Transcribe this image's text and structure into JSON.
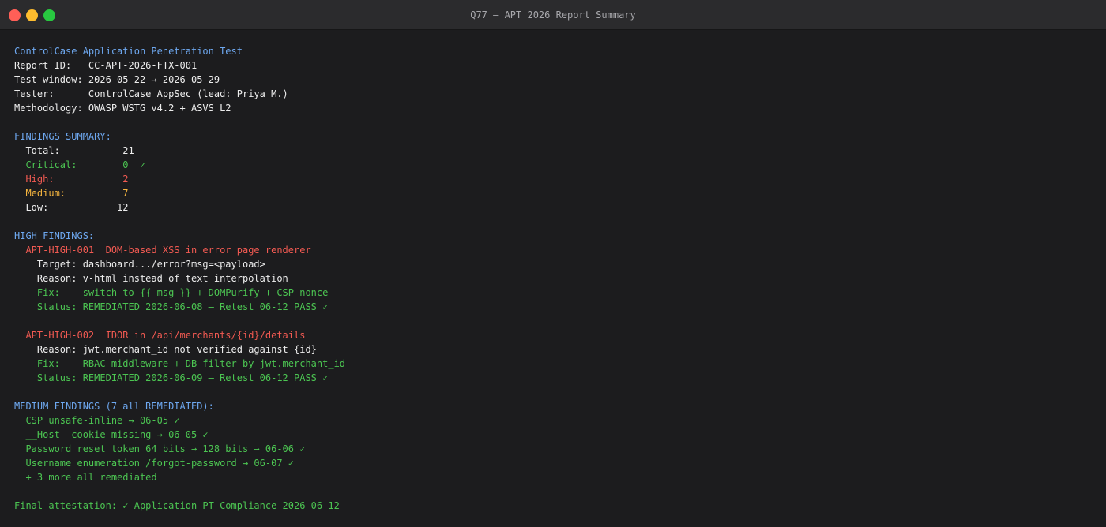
{
  "window": {
    "title": "Q77 — APT 2026 Report Summary"
  },
  "colors": {
    "heading": "#6ea8f0",
    "text": "#ededed",
    "success": "#4cc552",
    "high": "#f25a52",
    "medium": "#f5b53f",
    "background": "#1c1c1e",
    "titlebar": "#2b2b2d"
  },
  "report": {
    "heading": "ControlCase Application Penetration Test",
    "report_id": "Report ID:   CC-APT-2026-FTX-001",
    "test_window": "Test window: 2026-05-22 → 2026-05-29",
    "tester": "Tester:      ControlCase AppSec (lead: Priya M.)",
    "methodology": "Methodology: OWASP WSTG v4.2 + ASVS L2"
  },
  "summary": {
    "heading": "FINDINGS SUMMARY:",
    "total": "  Total:           21",
    "critical": "  Critical:        0  ✓",
    "high": "  High:            2",
    "medium": "  Medium:          7",
    "low": "  Low:            12"
  },
  "high_findings": {
    "heading": "HIGH FINDINGS:",
    "items": [
      {
        "title": "  APT-HIGH-001  DOM-based XSS in error page renderer",
        "details": [
          {
            "text": "    Target: dashboard.../error?msg=<payload>",
            "tone": "white"
          },
          {
            "text": "    Reason: v-html instead of text interpolation",
            "tone": "white"
          },
          {
            "text": "    Fix:    switch to {{ msg }} + DOMPurify + CSP nonce",
            "tone": "green"
          },
          {
            "text": "    Status: REMEDIATED 2026-06-08 — Retest 06-12 PASS ✓",
            "tone": "green"
          }
        ]
      },
      {
        "title": "  APT-HIGH-002  IDOR in /api/merchants/{id}/details",
        "details": [
          {
            "text": "    Reason: jwt.merchant_id not verified against {id}",
            "tone": "white"
          },
          {
            "text": "    Fix:    RBAC middleware + DB filter by jwt.merchant_id",
            "tone": "green"
          },
          {
            "text": "    Status: REMEDIATED 2026-06-09 — Retest 06-12 PASS ✓",
            "tone": "green"
          }
        ]
      }
    ]
  },
  "medium_findings": {
    "heading": "MEDIUM FINDINGS (7 all REMEDIATED):",
    "items": [
      "  CSP unsafe-inline → 06-05 ✓",
      "  __Host- cookie missing → 06-05 ✓",
      "  Password reset token 64 bits → 128 bits → 06-06 ✓",
      "  Username enumeration /forgot-password → 06-07 ✓",
      "  + 3 more all remediated"
    ]
  },
  "attestation": "Final attestation: ✓ Application PT Compliance 2026-06-12"
}
